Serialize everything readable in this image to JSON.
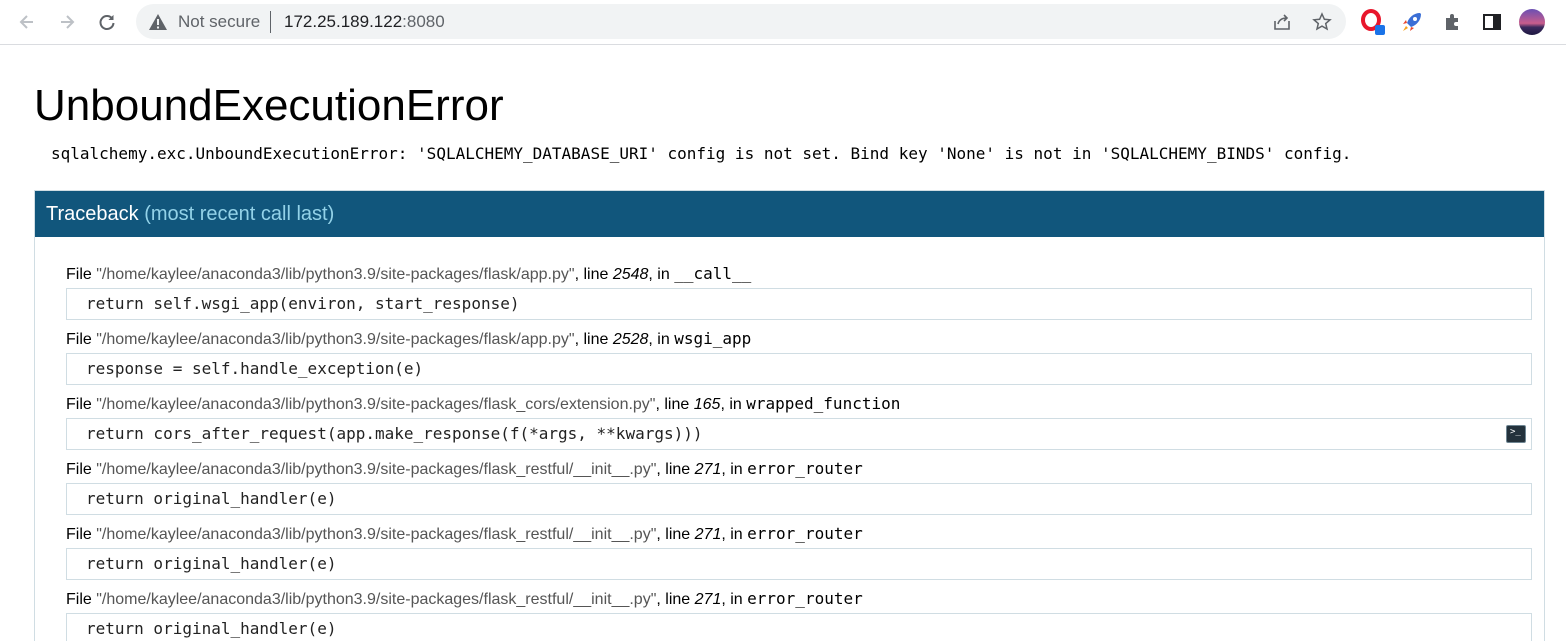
{
  "browser": {
    "security_label": "Not secure",
    "url_host": "172.25.189.122",
    "url_port": ":8080"
  },
  "page": {
    "title": "UnboundExecutionError",
    "error_message": "sqlalchemy.exc.UnboundExecutionError: 'SQLALCHEMY_DATABASE_URI' config is not set. Bind key 'None' is not in 'SQLALCHEMY_BINDS' config."
  },
  "traceback": {
    "header": "Traceback",
    "header_sub": "(most recent call last)",
    "frames": [
      {
        "file_prefix": "File ",
        "file": "\"/home/kaylee/anaconda3/lib/python3.9/site-packages/flask/app.py\"",
        "line_label": ", line ",
        "line": "2548",
        "in_label": ", in ",
        "func": "__call__",
        "code": "return self.wsgi_app(environ, start_response)"
      },
      {
        "file_prefix": "File ",
        "file": "\"/home/kaylee/anaconda3/lib/python3.9/site-packages/flask/app.py\"",
        "line_label": ", line ",
        "line": "2528",
        "in_label": ", in ",
        "func": "wsgi_app",
        "code": "response = self.handle_exception(e)"
      },
      {
        "file_prefix": "File ",
        "file": "\"/home/kaylee/anaconda3/lib/python3.9/site-packages/flask_cors/extension.py\"",
        "line_label": ", line ",
        "line": "165",
        "in_label": ", in ",
        "func": "wrapped_function",
        "code": "return cors_after_request(app.make_response(f(*args, **kwargs)))"
      },
      {
        "file_prefix": "File ",
        "file": "\"/home/kaylee/anaconda3/lib/python3.9/site-packages/flask_restful/__init__.py\"",
        "line_label": ", line ",
        "line": "271",
        "in_label": ", in ",
        "func": "error_router",
        "code": "return original_handler(e)"
      },
      {
        "file_prefix": "File ",
        "file": "\"/home/kaylee/anaconda3/lib/python3.9/site-packages/flask_restful/__init__.py\"",
        "line_label": ", line ",
        "line": "271",
        "in_label": ", in ",
        "func": "error_router",
        "code": "return original_handler(e)"
      },
      {
        "file_prefix": "File ",
        "file": "\"/home/kaylee/anaconda3/lib/python3.9/site-packages/flask_restful/__init__.py\"",
        "line_label": ", line ",
        "line": "271",
        "in_label": ", in ",
        "func": "error_router",
        "code": "return original_handler(e)"
      }
    ],
    "console_icon_glyph": ">_"
  },
  "colors": {
    "header_bg": "#11567c",
    "header_sub": "#93d2e8",
    "toolbar_bg": "#ffffff",
    "omnibox_bg": "#f1f3f4"
  },
  "icons": {
    "back": "arrow-left-icon",
    "forward": "arrow-right-icon",
    "reload": "reload-icon",
    "info": "warning-triangle-icon",
    "share": "share-icon",
    "bookmark": "star-icon",
    "ext1": "opera-extension-icon",
    "ext2": "rocket-extension-icon",
    "extensions": "puzzle-icon",
    "sidepanel": "side-panel-icon",
    "profile": "avatar"
  }
}
